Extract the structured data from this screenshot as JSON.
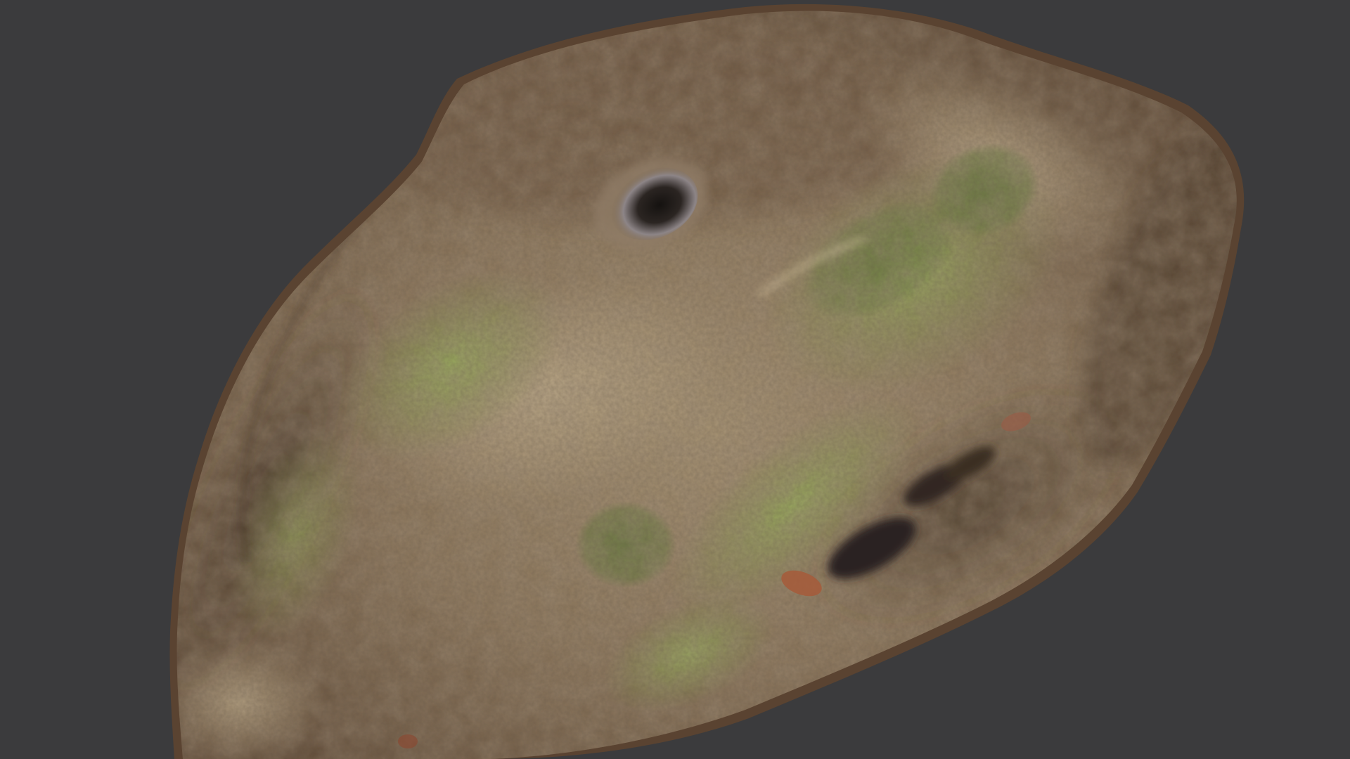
{
  "viewport": {
    "background_color": "#3b3b3d"
  },
  "model": {
    "subject": "photogrammetry-scanned-boulder",
    "colors": {
      "soil_dark": "#3f2f22",
      "soil_mid": "#6e5641",
      "rock_base": "#8a7459",
      "rock_light": "#b3a082",
      "sand": "#c9b08c",
      "moss_green": "#8fae4f",
      "moss_dark": "#5f7536",
      "hole_dark": "#1d1916",
      "hole_rim": "#a9a1a3",
      "leaf_red": "#a65a3a"
    }
  }
}
